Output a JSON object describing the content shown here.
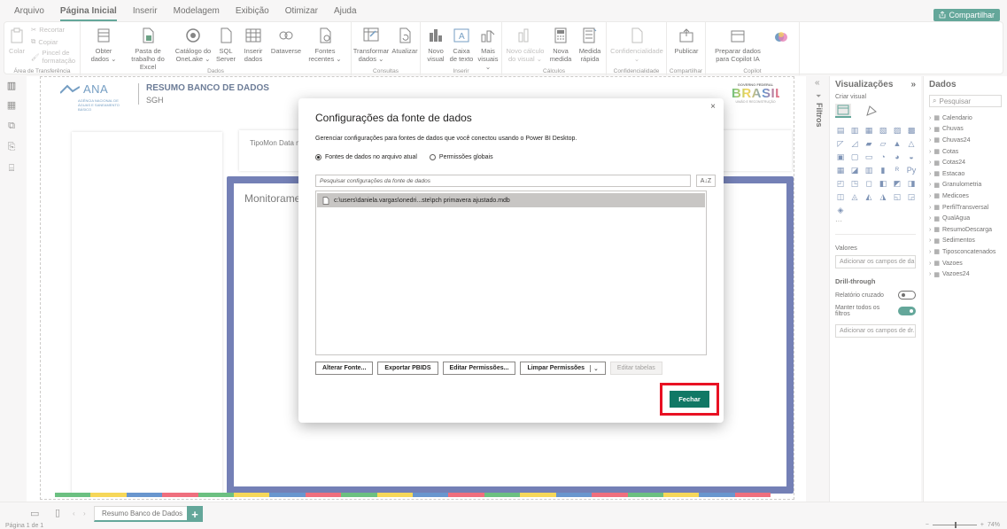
{
  "menu": {
    "items": [
      "Arquivo",
      "Página Inicial",
      "Inserir",
      "Modelagem",
      "Exibição",
      "Otimizar",
      "Ajuda"
    ],
    "active_index": 1,
    "share_label": "Compartilhar"
  },
  "ribbon": {
    "clipboard": {
      "paste": "Colar",
      "cut": "Recortar",
      "copy": "Copiar",
      "format_painter": "Pincel de formatação",
      "group": "Área de Transferência"
    },
    "data": {
      "get_data": "Obter dados ⌄",
      "excel": "Pasta de trabalho do Excel",
      "onelake": "Catálogo do OneLake ⌄",
      "sql": "SQL Server",
      "enter_data": "Inserir dados",
      "dataverse": "Dataverse",
      "recent": "Fontes recentes ⌄",
      "group": "Dados"
    },
    "queries": {
      "transform": "Transformar dados ⌄",
      "refresh": "Atualizar",
      "group": "Consultas"
    },
    "insert": {
      "new_visual": "Novo visual",
      "text_box": "Caixa de texto",
      "more_visuals": "Mais visuais ⌄",
      "group": "Inserir"
    },
    "calculations": {
      "new_calc": "Novo cálculo do visual ⌄",
      "new_measure": "Nova medida",
      "quick_measure": "Medida rápida",
      "group": "Cálculos"
    },
    "sensitivity": {
      "label": "Confidencialidade ⌄",
      "group": "Confidencialidade"
    },
    "share": {
      "publish": "Publicar",
      "group": "Compartilhar"
    },
    "copilot": {
      "prepare": "Preparar dados para Copilot IA",
      "group": "Copilot"
    }
  },
  "report": {
    "logo_text": "ANA",
    "logo_sub": "AGÊNCIA NACIONAL DE ÁGUAS E SANEAMENTO BÁSICO",
    "title": "RESUMO BANCO DE DADOS",
    "subtitle": "SGH",
    "gov_top": "GOVERNO FEDERAL",
    "gov_main": "BRASIL",
    "gov_bottom": "UNIÃO E RECONSTRUÇÃO",
    "filter_label": "TipoMon  Data mais",
    "monitor_title": "Monitoramen",
    "color_strip": [
      "#1e9e3e",
      "#f2c200",
      "#1a5fb4",
      "#e6233a",
      "#1e9e3e",
      "#f2c200",
      "#1a5fb4",
      "#e6233a",
      "#1e9e3e",
      "#f2c200",
      "#1a5fb4",
      "#e6233a",
      "#1e9e3e",
      "#f2c200",
      "#1a5fb4",
      "#e6233a",
      "#1e9e3e",
      "#f2c200",
      "#1a5fb4",
      "#e6233a"
    ]
  },
  "bottom": {
    "page_tab": "Resumo Banco de Dados",
    "add": "+",
    "status": "Página 1 de 1",
    "zoom": "74%"
  },
  "filters_pane": {
    "label": "Filtros"
  },
  "visualizations": {
    "title": "Visualizações",
    "build_visual": "Criar visual",
    "values_label": "Valores",
    "values_placeholder": "Adicionar os campos de da...",
    "drillthrough": "Drill-through",
    "cross_report": "Relatório cruzado",
    "keep_filters": "Manter todos os filtros",
    "drill_placeholder": "Adicionar os campos de dr...",
    "more": "···"
  },
  "data_pane": {
    "title": "Dados",
    "search_placeholder": "Pesquisar",
    "tables": [
      "Calendario",
      "Chuvas",
      "Chuvas24",
      "Cotas",
      "Cotas24",
      "Estacao",
      "Granulometria",
      "Medicoes",
      "PerfilTransversal",
      "QualAgua",
      "ResumoDescarga",
      "Sedimentos",
      "Tiposconcatenados",
      "Vazoes",
      "Vazoes24"
    ]
  },
  "dialog": {
    "title": "Configurações da fonte de dados",
    "description": "Gerenciar configurações para fontes de dados que você conectou usando o Power BI Desktop.",
    "radio_current": "Fontes de dados no arquivo atual",
    "radio_global": "Permissões globais",
    "search_placeholder": "Pesquisar configurações da fonte de dados",
    "sort": "A↓Z",
    "selected_source": "c:\\users\\daniela.vargas\\onedri...ste\\pch primavera ajustado.mdb",
    "btn_change": "Alterar Fonte...",
    "btn_export": "Exportar PBIDS",
    "btn_edit_perm": "Editar Permissões...",
    "btn_clear_perm": "Limpar Permissões",
    "btn_edit_tables": "Editar tabelas",
    "btn_close": "Fechar",
    "close_x": "×"
  },
  "colors": {
    "accent": "#117865",
    "highlight": "#e81123",
    "frame": "#2a3d8f"
  }
}
